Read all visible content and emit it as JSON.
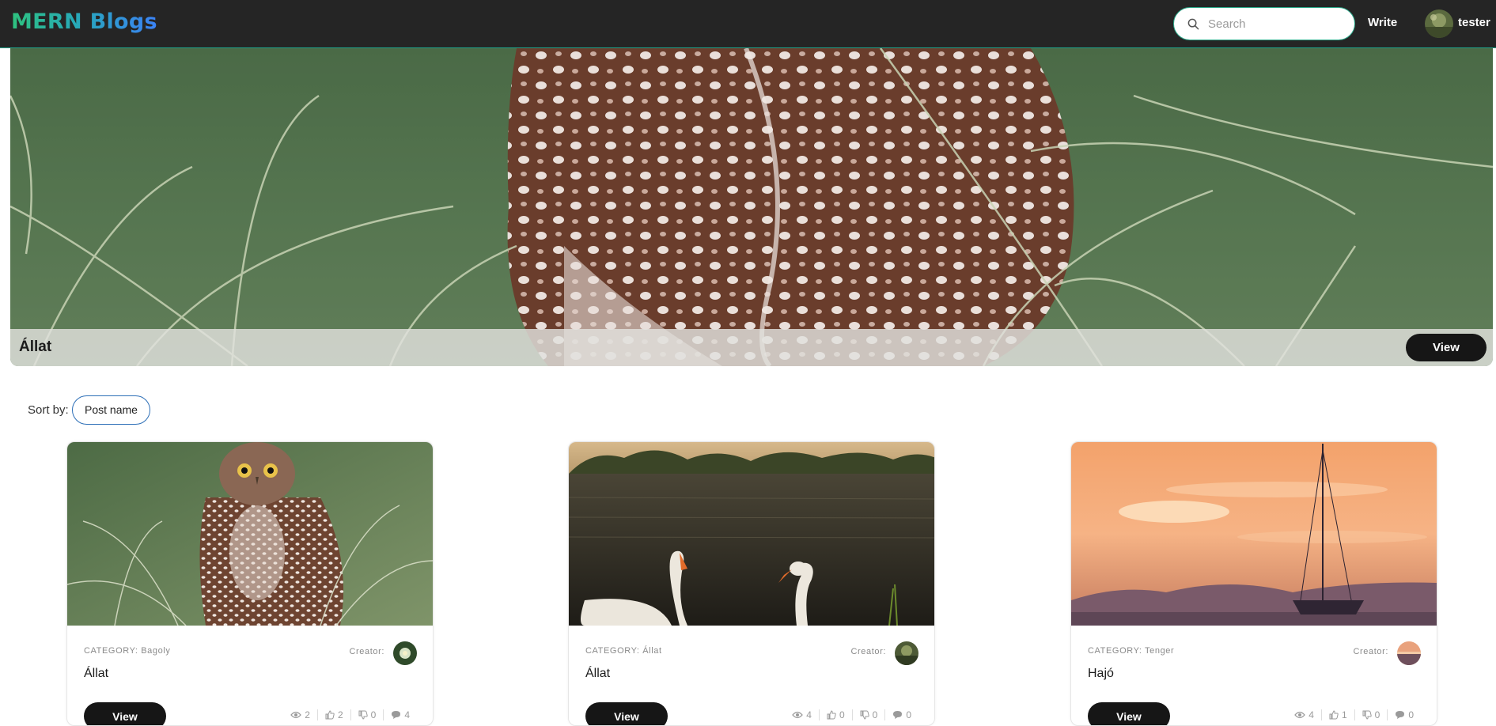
{
  "brand": "MERN Blogs",
  "nav": {
    "search_placeholder": "Search",
    "write_label": "Write",
    "username": "tester"
  },
  "hero": {
    "title": "Állat",
    "view_label": "View"
  },
  "sort": {
    "label": "Sort by:",
    "selected": "Post name"
  },
  "posts": [
    {
      "category_prefix": "CATEGORY:",
      "category": "Bagoly",
      "creator_label": "Creator:",
      "title": "Állat",
      "view_label": "View",
      "views": "2",
      "likes": "2",
      "dislikes": "0",
      "comments": "4",
      "image": "owl-photo"
    },
    {
      "category_prefix": "CATEGORY:",
      "category": "Állat",
      "creator_label": "Creator:",
      "title": "Állat",
      "view_label": "View",
      "views": "4",
      "likes": "0",
      "dislikes": "0",
      "comments": "0",
      "image": "swans-photo"
    },
    {
      "category_prefix": "CATEGORY:",
      "category": "Tenger",
      "creator_label": "Creator:",
      "title": "Hajó",
      "view_label": "View",
      "views": "4",
      "likes": "1",
      "dislikes": "0",
      "comments": "0",
      "image": "sailboat-sunset-photo"
    }
  ],
  "colors": {
    "navbar_bg": "#252525",
    "accent": "#2aa889",
    "button_bg": "#161616"
  }
}
